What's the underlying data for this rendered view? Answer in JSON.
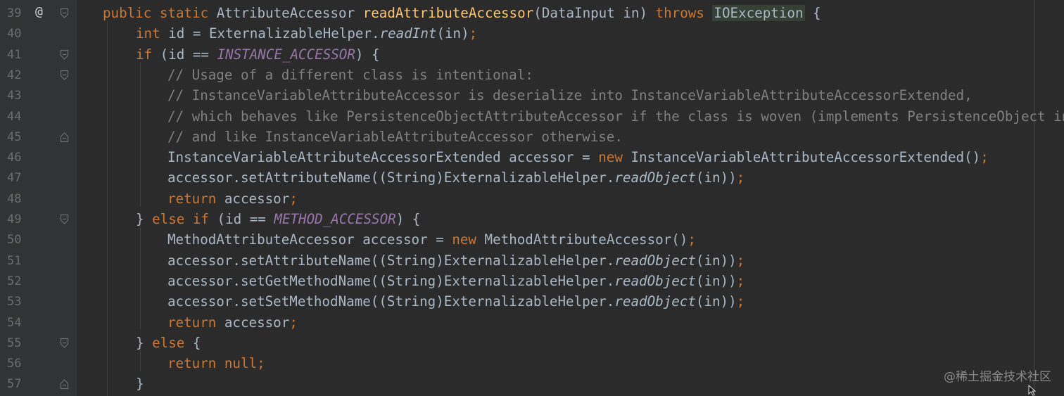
{
  "editor": {
    "watermark": "@稀土掘金技术社区",
    "override_marker": "@",
    "lines": [
      {
        "num": "39",
        "segments": [
          {
            "t": "public static ",
            "c": "kw"
          },
          {
            "t": "AttributeAccessor ",
            "c": "p"
          },
          {
            "t": "readAttributeAccessor",
            "c": "fn"
          },
          {
            "t": "(DataInput in) ",
            "c": "p"
          },
          {
            "t": "throws ",
            "c": "kw"
          },
          {
            "t": "IOException",
            "c": "exc"
          },
          {
            "t": " {",
            "c": "p"
          }
        ]
      },
      {
        "num": "40",
        "segments": [
          {
            "t": "int ",
            "c": "kw"
          },
          {
            "t": "id = ExternalizableHelper.",
            "c": "p"
          },
          {
            "t": "readInt",
            "c": "it"
          },
          {
            "t": "(in)",
            "c": "p"
          },
          {
            "t": ";",
            "c": "op"
          }
        ]
      },
      {
        "num": "41",
        "segments": [
          {
            "t": "if ",
            "c": "kw"
          },
          {
            "t": "(id == ",
            "c": "p"
          },
          {
            "t": "INSTANCE_ACCESSOR",
            "c": "cs"
          },
          {
            "t": ") {",
            "c": "p"
          }
        ]
      },
      {
        "num": "42",
        "segments": [
          {
            "t": "// Usage of a different class is intentional:",
            "c": "cm"
          }
        ]
      },
      {
        "num": "43",
        "segments": [
          {
            "t": "// InstanceVariableAttributeAccessor is deserialize into InstanceVariableAttributeAccessorExtended,",
            "c": "cm"
          }
        ]
      },
      {
        "num": "44",
        "segments": [
          {
            "t": "// which behaves like PersistenceObjectAttributeAccessor if the class is woven (implements PersistenceObject int",
            "c": "cm"
          }
        ]
      },
      {
        "num": "45",
        "segments": [
          {
            "t": "// and like InstanceVariableAttributeAccessor otherwise.",
            "c": "cm"
          }
        ]
      },
      {
        "num": "46",
        "segments": [
          {
            "t": "InstanceVariableAttributeAccessorExtended accessor = ",
            "c": "p"
          },
          {
            "t": "new ",
            "c": "kw"
          },
          {
            "t": "InstanceVariableAttributeAccessorExtended()",
            "c": "p"
          },
          {
            "t": ";",
            "c": "op"
          }
        ]
      },
      {
        "num": "47",
        "segments": [
          {
            "t": "accessor.setAttributeName((String)ExternalizableHelper.",
            "c": "p"
          },
          {
            "t": "readObject",
            "c": "it"
          },
          {
            "t": "(in))",
            "c": "p"
          },
          {
            "t": ";",
            "c": "op"
          }
        ]
      },
      {
        "num": "48",
        "segments": [
          {
            "t": "return ",
            "c": "kw"
          },
          {
            "t": "accessor",
            "c": "p"
          },
          {
            "t": ";",
            "c": "op"
          }
        ]
      },
      {
        "num": "49",
        "segments": [
          {
            "t": "} ",
            "c": "p"
          },
          {
            "t": "else if ",
            "c": "kw"
          },
          {
            "t": "(id == ",
            "c": "p"
          },
          {
            "t": "METHOD_ACCESSOR",
            "c": "cs"
          },
          {
            "t": ") {",
            "c": "p"
          }
        ]
      },
      {
        "num": "50",
        "segments": [
          {
            "t": "MethodAttributeAccessor accessor = ",
            "c": "p"
          },
          {
            "t": "new ",
            "c": "kw"
          },
          {
            "t": "MethodAttributeAccessor()",
            "c": "p"
          },
          {
            "t": ";",
            "c": "op"
          }
        ]
      },
      {
        "num": "51",
        "segments": [
          {
            "t": "accessor.setAttributeName((String)ExternalizableHelper.",
            "c": "p"
          },
          {
            "t": "readObject",
            "c": "it"
          },
          {
            "t": "(in))",
            "c": "p"
          },
          {
            "t": ";",
            "c": "op"
          }
        ]
      },
      {
        "num": "52",
        "segments": [
          {
            "t": "accessor.setGetMethodName((String)ExternalizableHelper.",
            "c": "p"
          },
          {
            "t": "readObject",
            "c": "it"
          },
          {
            "t": "(in))",
            "c": "p"
          },
          {
            "t": ";",
            "c": "op"
          }
        ]
      },
      {
        "num": "53",
        "segments": [
          {
            "t": "accessor.setSetMethodName((String)ExternalizableHelper.",
            "c": "p"
          },
          {
            "t": "readObject",
            "c": "it"
          },
          {
            "t": "(in))",
            "c": "p"
          },
          {
            "t": ";",
            "c": "op"
          }
        ]
      },
      {
        "num": "54",
        "segments": [
          {
            "t": "return ",
            "c": "kw"
          },
          {
            "t": "accessor",
            "c": "p"
          },
          {
            "t": ";",
            "c": "op"
          }
        ]
      },
      {
        "num": "55",
        "segments": [
          {
            "t": "} ",
            "c": "p"
          },
          {
            "t": "else ",
            "c": "kw"
          },
          {
            "t": "{",
            "c": "p"
          }
        ]
      },
      {
        "num": "56",
        "segments": [
          {
            "t": "return null",
            "c": "kw"
          },
          {
            "t": ";",
            "c": "op"
          }
        ]
      },
      {
        "num": "57",
        "segments": [
          {
            "t": "}",
            "c": "p"
          }
        ]
      }
    ]
  }
}
